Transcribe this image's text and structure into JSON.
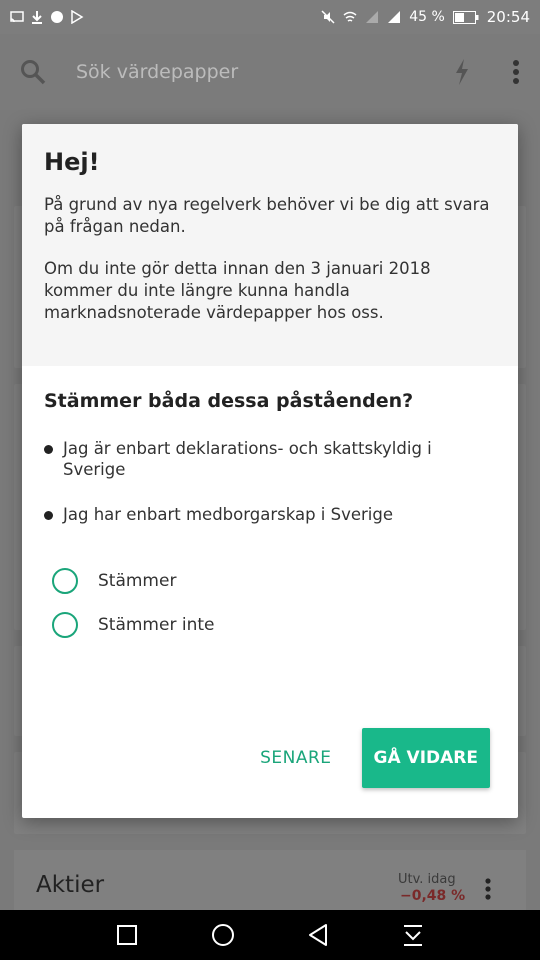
{
  "status": {
    "battery": "45 %",
    "time": "20:54"
  },
  "search": {
    "placeholder": "Sök värdepapper"
  },
  "dialog": {
    "title": "Hej!",
    "paragraph1": "På grund av nya regelverk behöver vi be dig att svara på frågan nedan.",
    "paragraph2": "Om du inte gör detta innan den 3 januari 2018 kommer du inte längre kunna handla marknadsnoterade värdepapper hos oss.",
    "question": "Stämmer båda dessa påståenden?",
    "bullets": [
      "Jag är enbart deklarations- och skattskyldig i Sverige",
      "Jag har enbart medborgarskap i Sverige"
    ],
    "options": [
      "Stämmer",
      "Stämmer inte"
    ],
    "later_label": "SENARE",
    "continue_label": "GÅ VIDARE"
  },
  "aktier": {
    "title": "Aktier",
    "change_label": "Utv. idag",
    "change_value": "−0,48 %"
  },
  "colors": {
    "accent": "#19b88a",
    "negative": "#c0392b"
  }
}
